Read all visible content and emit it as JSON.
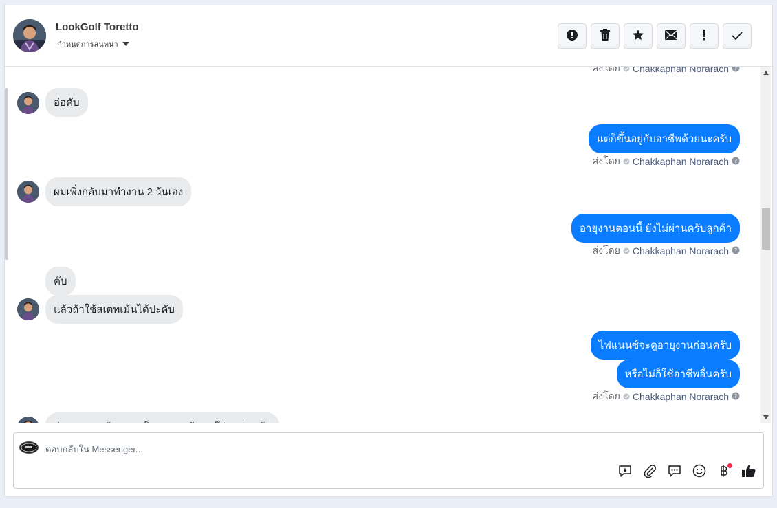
{
  "contact": {
    "name": "LookGolf Toretto",
    "subtitle": "กำหนดการสนทนา"
  },
  "toolbar": {
    "buttons": [
      "spam-report",
      "delete",
      "star",
      "mark-unread",
      "important",
      "mark-done"
    ]
  },
  "messages": {
    "partial_top": {
      "prefix": "ส่งโดย",
      "sender": "Chakkaphan Norarach"
    },
    "in1": "อ่อคับ",
    "out1": "แต่ก็ขึ้นอยู่กับอาชีพด้วยนะครับ",
    "sent1": {
      "prefix": "ส่งโดย",
      "sender": "Chakkaphan Norarach"
    },
    "in2": "ผมเพิ่งกลับมาทำงาน 2 วันเอง",
    "out2": "อายุงานตอนนี้ ยังไม่ผ่านครับลูกค้า",
    "sent2": {
      "prefix": "ส่งโดย",
      "sender": "Chakkaphan Norarach"
    },
    "in3a": "คับ",
    "in3b": "แล้วถ้าใช้สเตทเม้นได้ปะคับ",
    "out3a": "ไฟแนนซ์จะดูอายุงานก่อนครับ",
    "out3b": "หรือไม่ก็ใช้อาชีพอื่นครับ",
    "sent3": {
      "prefix": "ส่งโดย",
      "sender": "Chakkaphan Norarach"
    },
    "in4": "ก่อนจะมาสมัครงาน ก็ขายของขับแกร๊ปมาก่อนคับ"
  },
  "reply": {
    "placeholder": "ตอบกลับใน Messenger...",
    "value": ""
  },
  "colors": {
    "outgoing_bubble": "#0a7cff",
    "incoming_bubble": "#e9eaeb",
    "notification_dot": "#f02849"
  }
}
